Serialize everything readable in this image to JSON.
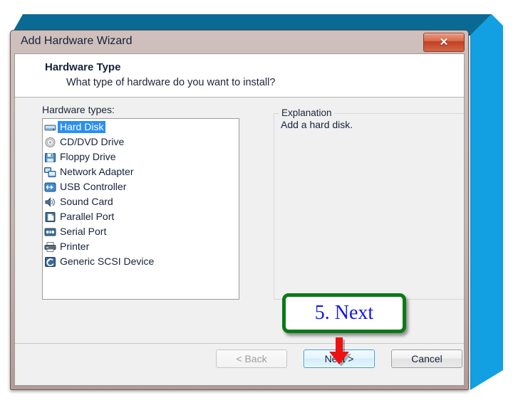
{
  "window": {
    "title": "Add Hardware Wizard",
    "close_label": "✕",
    "close_icon": "close-x-icon"
  },
  "header": {
    "title": "Hardware Type",
    "subtitle": "What type of hardware do you want to install?"
  },
  "list": {
    "label": "Hardware types:",
    "selected_index": 0,
    "items": [
      {
        "label": "Hard Disk",
        "icon": "hard-disk-icon"
      },
      {
        "label": "CD/DVD Drive",
        "icon": "optical-disc-icon"
      },
      {
        "label": "Floppy Drive",
        "icon": "floppy-disk-icon"
      },
      {
        "label": "Network Adapter",
        "icon": "network-adapter-icon"
      },
      {
        "label": "USB Controller",
        "icon": "usb-icon"
      },
      {
        "label": "Sound Card",
        "icon": "speaker-icon"
      },
      {
        "label": "Parallel Port",
        "icon": "parallel-port-icon"
      },
      {
        "label": "Serial Port",
        "icon": "serial-port-icon"
      },
      {
        "label": "Printer",
        "icon": "printer-icon"
      },
      {
        "label": "Generic SCSI Device",
        "icon": "scsi-device-icon"
      }
    ]
  },
  "explanation": {
    "legend": "Explanation",
    "text": "Add a hard disk."
  },
  "buttons": {
    "back": "< Back",
    "next": "Next >",
    "cancel": "Cancel"
  },
  "annotation": {
    "text": "5. Next",
    "box_color": "#0a7a16",
    "text_color": "#1414ef",
    "arrow_color": "#ee1111",
    "arrow_icon": "down-arrow-icon"
  },
  "colors": {
    "backdrop_blue": "#0d8bd0",
    "backdrop_blue_dark": "#0b6a94",
    "frame_mauve": "#c6b5b2",
    "selection_blue": "#2a8ff0",
    "client_gray": "#f0f0f0"
  }
}
